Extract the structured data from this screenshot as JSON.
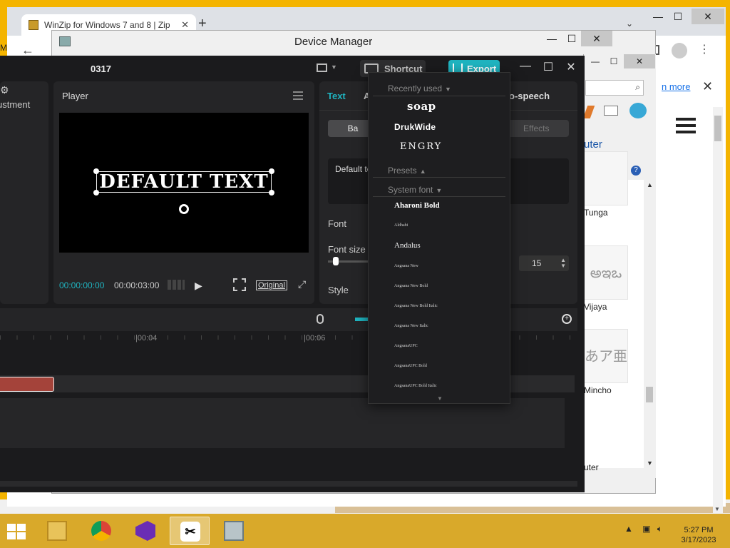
{
  "chrome": {
    "tab_title": "WinZip for Windows 7 and 8 | Zip",
    "new_tab": "+",
    "banner_link": "n more",
    "left_stub": "M"
  },
  "device_manager": {
    "title": "Device Manager"
  },
  "font_window": {
    "breadcrumb": "uter",
    "fonts": [
      {
        "name": "Tunga",
        "preview": ""
      },
      {
        "name": "Vijaya",
        "preview": "అఇఒ"
      },
      {
        "name": "Mincho",
        "preview": "あア亜"
      }
    ],
    "status": "uter"
  },
  "capcut": {
    "project_name": "0317",
    "shortcut_label": "Shortcut",
    "export_label": "Export",
    "left_panel_label": "ustment",
    "player": {
      "title": "Player",
      "canvas_text": "DEFAULT TEXT",
      "current_time": "00:00:00:00",
      "total_time": "00:00:03:00",
      "ratio_label": "Original"
    },
    "inspector": {
      "tab_text": "Text",
      "tab_a": "A",
      "tab_tts": "o-speech",
      "seg_basic": "Ba",
      "seg_effects": "Effects",
      "text_value": "Default te",
      "font_label": "Font",
      "font_size_label": "Font size",
      "font_size_value": "15",
      "font_size_fraction": 0.1,
      "style_label": "Style"
    },
    "timeline": {
      "ticks": [
        "|00:04",
        "|00:06"
      ]
    }
  },
  "font_dropdown": {
    "recently_used_label": "Recently used",
    "recent": [
      "soap",
      "DrukWide",
      "ENGRY"
    ],
    "presets_label": "Presets",
    "system_font_label": "System font",
    "system_fonts": [
      "Aharoni Bold",
      "Aldhabi",
      "Andalus",
      "Angsana New",
      "Angsana New Bold",
      "Angsana New Bold Italic",
      "Angsana New Italic",
      "AngsanaUPC",
      "AngsanaUPC Bold",
      "AngsanaUPC Bold Italic"
    ]
  },
  "taskbar": {
    "time": "5:27 PM",
    "date": "3/17/2023",
    "apps": [
      "file-explorer",
      "chrome",
      "visual-studio",
      "capcut",
      "device-manager"
    ],
    "active_app": "capcut"
  },
  "colors": {
    "desktop": "#f4b400",
    "accent": "#1fb4c0",
    "clip": "#a4433a"
  }
}
